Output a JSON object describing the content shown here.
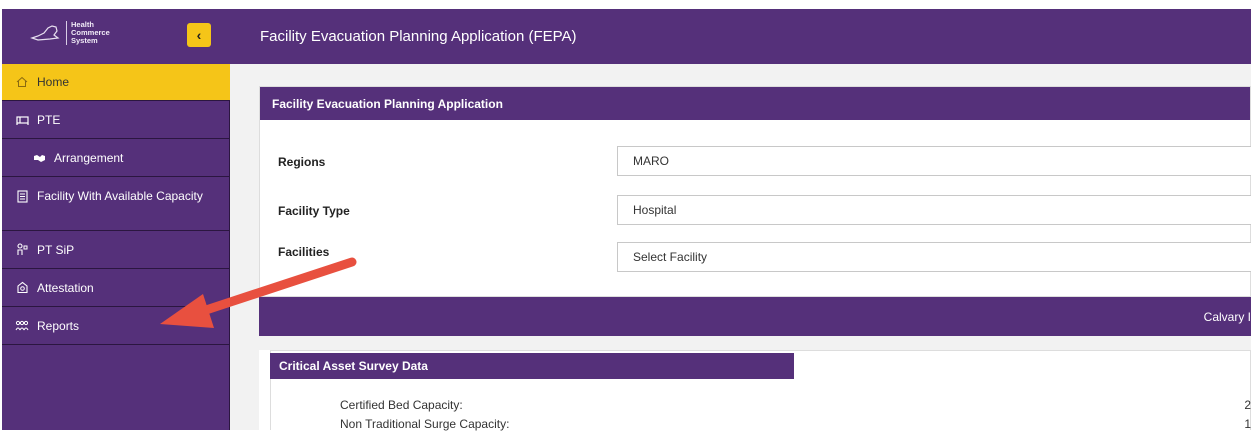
{
  "app": {
    "window_title": "Facility Evacuation Planning Application (FEPA)",
    "logo_text": [
      "Health",
      "Commerce",
      "System"
    ]
  },
  "sidebar": {
    "collapse_icon": "chevron-left-icon",
    "items": [
      {
        "label": "Home",
        "icon": "home-icon",
        "active": true
      },
      {
        "label": "PTE",
        "icon": "bed-icon"
      },
      {
        "label": "Arrangement",
        "icon": "handshake-icon"
      },
      {
        "label": "Facility With Available Capacity",
        "icon": "building-icon"
      },
      {
        "label": "PT SiP",
        "icon": "person-icon"
      },
      {
        "label": "Attestation",
        "icon": "certificate-icon"
      },
      {
        "label": "Reports",
        "icon": "people-icon"
      }
    ]
  },
  "main": {
    "card_title": "Facility Evacuation Planning Application",
    "filters": [
      {
        "label": "Regions",
        "value": "MARO"
      },
      {
        "label": "Facility Type",
        "value": "Hospital"
      },
      {
        "label": "Facilities",
        "value": "Select Facility"
      }
    ],
    "band_text": "Calvary I",
    "survey": {
      "title": "Critical Asset Survey Data",
      "rows": [
        {
          "label": "Certified Bed Capacity:",
          "value": "2"
        },
        {
          "label": "Non Traditional Surge Capacity:",
          "value": "1"
        }
      ]
    }
  },
  "colors": {
    "brand_purple": "#55307a",
    "highlight_yellow": "#f5c518",
    "annotation_red": "#e8503f"
  }
}
